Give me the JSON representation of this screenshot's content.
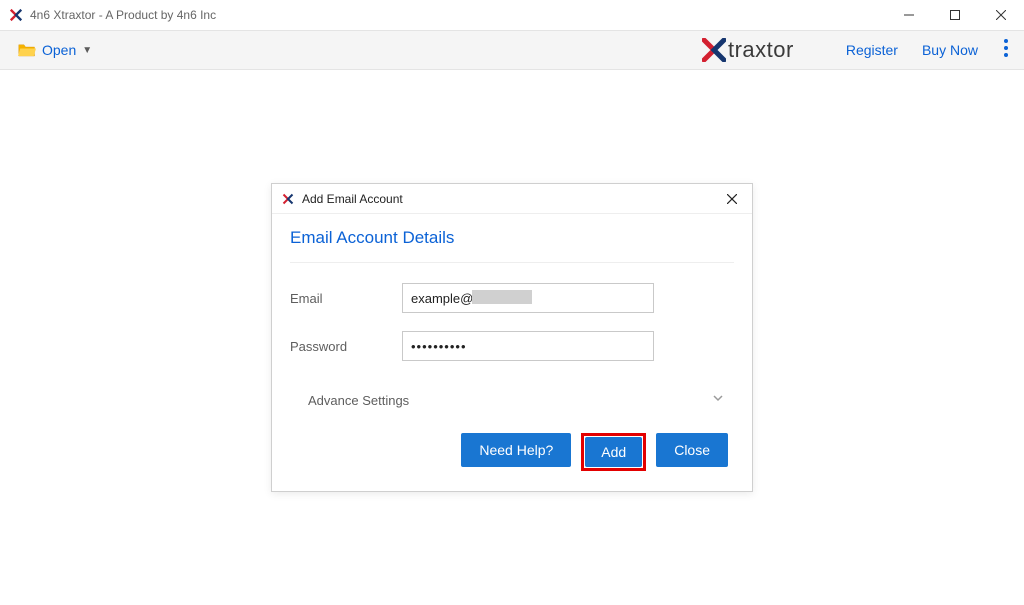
{
  "window": {
    "title": "4n6 Xtraxtor - A Product by 4n6 Inc"
  },
  "toolbar": {
    "open_label": "Open",
    "brand_text": "traxtor",
    "register_label": "Register",
    "buy_now_label": "Buy Now"
  },
  "dialog": {
    "title": "Add Email Account",
    "heading": "Email Account Details",
    "email_label": "Email",
    "email_value": "example@",
    "password_label": "Password",
    "password_value": "••••••••••",
    "advance_label": "Advance Settings",
    "need_help_label": "Need Help?",
    "add_label": "Add",
    "close_label": "Close"
  },
  "colors": {
    "accent": "#0b62d6",
    "button": "#1976d2",
    "highlight": "#e30000"
  }
}
